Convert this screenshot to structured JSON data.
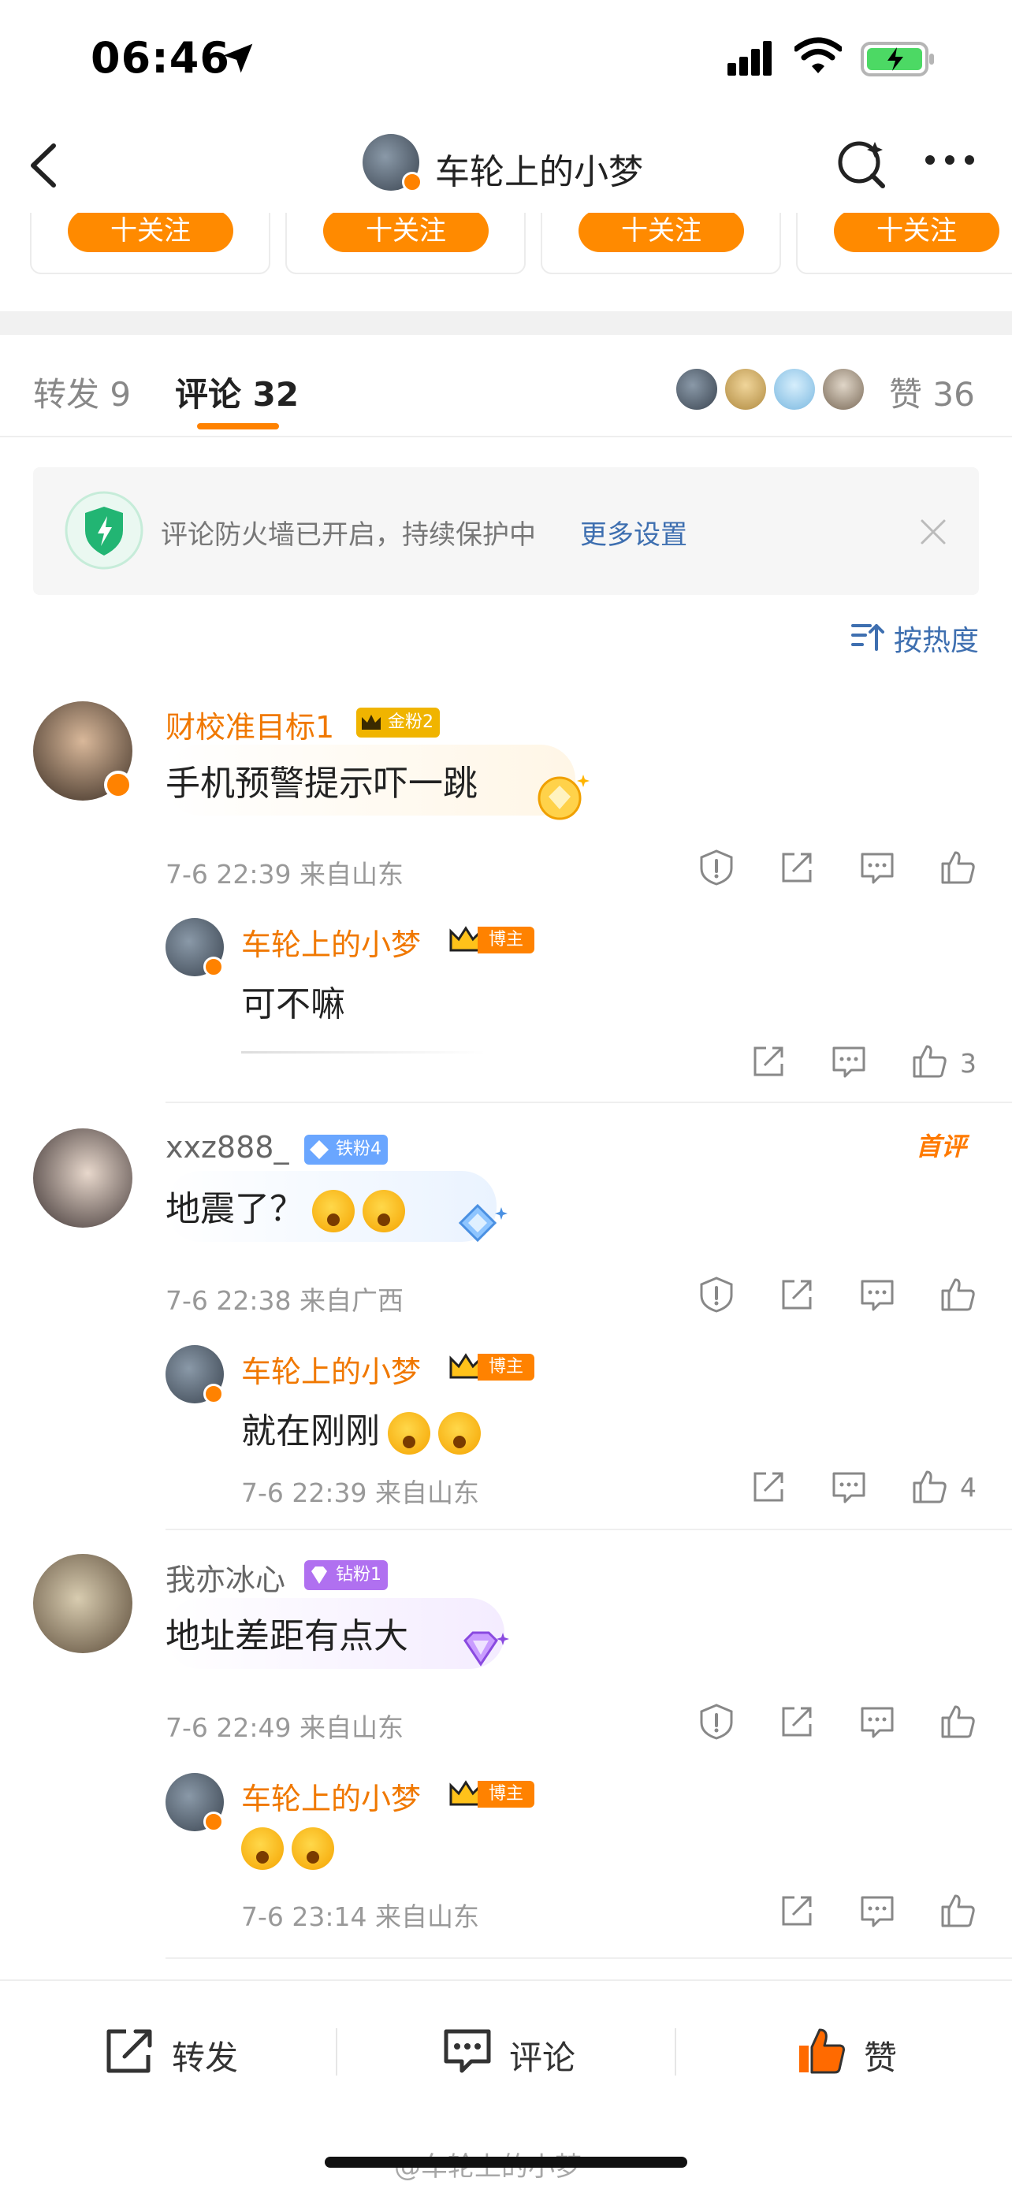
{
  "status_bar": {
    "time": "06:46"
  },
  "nav": {
    "title": "车轮上的小梦"
  },
  "follow_row": {
    "button_label": "十关注"
  },
  "tabs": {
    "repost": "转发 9",
    "comment": "评论 32",
    "likes": "赞 36"
  },
  "firewall": {
    "text": "评论防火墙已开启，持续保护中",
    "link": "更多设置"
  },
  "sort": {
    "label": "按热度"
  },
  "comments": [
    {
      "name": "财校准目标1",
      "badge": "金粉2",
      "text": "手机预警提示吓一跳",
      "meta": "7-6 22:39  来自山东",
      "reply": {
        "name": "车轮上的小梦",
        "badge": "博主",
        "text": "可不嘛",
        "meta": "",
        "likes": "3"
      }
    },
    {
      "name": "xxz888_",
      "badge": "铁粉4",
      "tag": "首评",
      "text": "地震了？",
      "meta": "7-6 22:38  来自广西",
      "reply": {
        "name": "车轮上的小梦",
        "badge": "博主",
        "text": "就在刚刚",
        "meta": "7-6 22:39  来自山东",
        "likes": "4"
      }
    },
    {
      "name": "我亦冰心",
      "badge": "钻粉1",
      "text": "地址差距有点大",
      "meta": "7-6 22:49  来自山东",
      "reply": {
        "name": "车轮上的小梦",
        "badge": "博主",
        "text": "",
        "meta": "7-6 23:14  来自山东",
        "likes": ""
      }
    }
  ],
  "bottom_bar": {
    "repost": "转发",
    "comment": "评论",
    "like": "赞"
  },
  "watermark": "@车轮上的小梦",
  "colors": {
    "accent": "#ff8200",
    "link": "#3e6fb0",
    "gold_badge": "#f0b400",
    "iron_badge": "#6aa6ff",
    "diamond_badge": "#b070f0"
  }
}
